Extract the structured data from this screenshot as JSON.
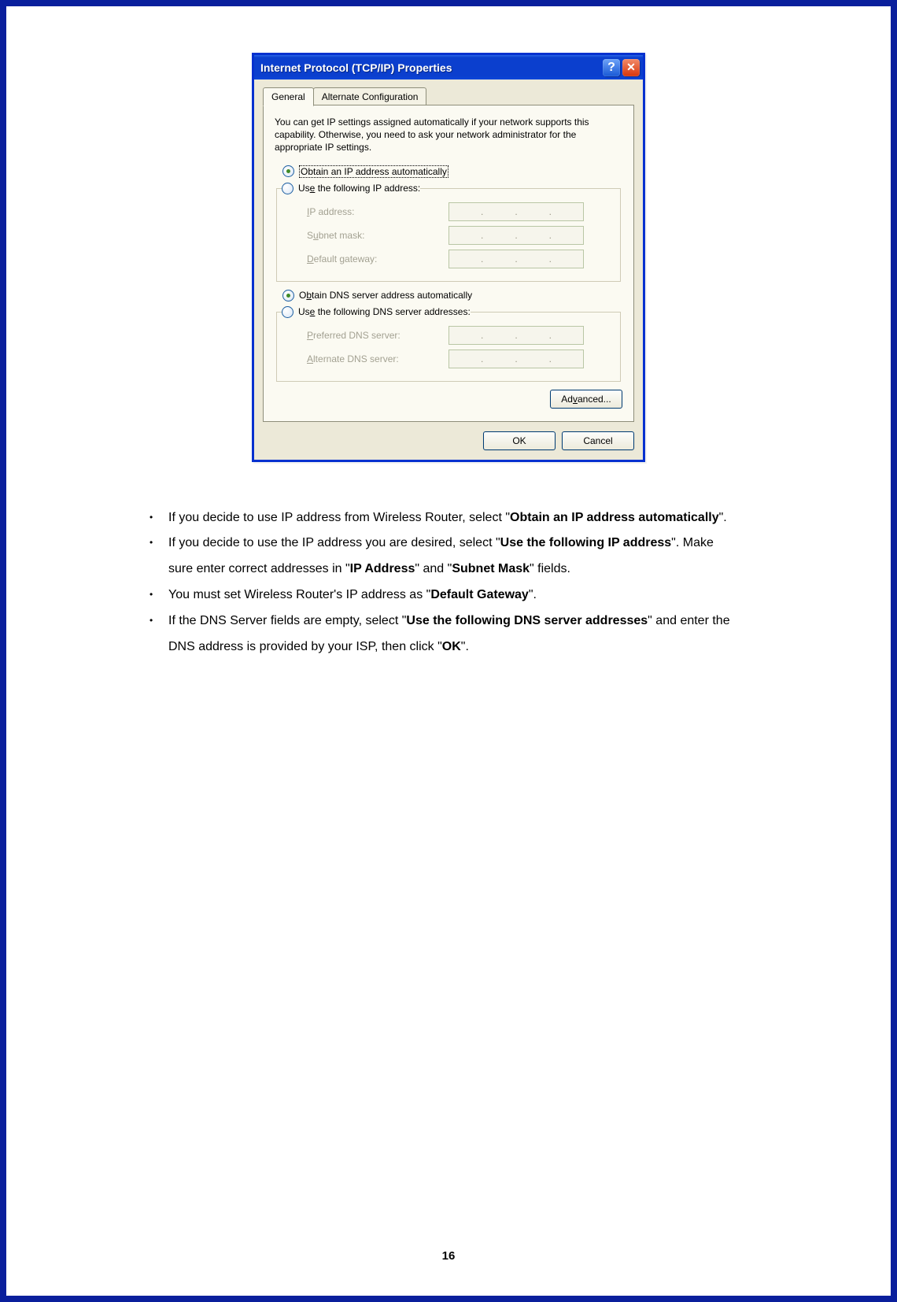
{
  "dialog": {
    "title": "Internet Protocol (TCP/IP) Properties",
    "tabs": {
      "general": "General",
      "alt": "Alternate Configuration"
    },
    "desc": "You can get IP settings assigned automatically if your network supports this capability. Otherwise, you need to ask your network administrator for the appropriate IP settings.",
    "radio_auto_ip": "Obtain an IP address automatically",
    "radio_use_ip_pre": "Us",
    "radio_use_ip_u": "e",
    "radio_use_ip_post": " the following IP address:",
    "ip_label_u": "I",
    "ip_label_post": "P address:",
    "subnet_pre": "S",
    "subnet_u": "u",
    "subnet_post": "bnet mask:",
    "gateway_u": "D",
    "gateway_post": "efault gateway:",
    "radio_auto_dns_pre": "O",
    "radio_auto_dns_u": "b",
    "radio_auto_dns_post": "tain DNS server address automatically",
    "radio_use_dns_pre": "Us",
    "radio_use_dns_u": "e",
    "radio_use_dns_post": " the following DNS server addresses:",
    "pref_dns_u": "P",
    "pref_dns_post": "referred DNS server:",
    "alt_dns_u": "A",
    "alt_dns_post": "lternate DNS server:",
    "advanced_pre": "Ad",
    "advanced_u": "v",
    "advanced_post": "anced...",
    "ok": "OK",
    "cancel": "Cancel"
  },
  "bullets": {
    "b1_a": "If you decide to use IP address from Wireless Router, select \"",
    "b1_bold": "Obtain an IP address automatically",
    "b1_b": "\".",
    "b2_a": "If you decide to use the IP address you are desired, select \"",
    "b2_bold1": "Use the following IP address",
    "b2_b": "\".    Make sure enter correct addresses in \"",
    "b2_bold2": "IP Address",
    "b2_c": "\" and \"",
    "b2_bold3": "Subnet Mask",
    "b2_d": "\" fields.",
    "b3_a": "You must set Wireless Router's IP address as \"",
    "b3_bold": "Default Gateway",
    "b3_b": "\".",
    "b4_a": "If the DNS Server fields are empty, select \"",
    "b4_bold1": "Use the following DNS server addresses",
    "b4_b": "\" and enter the DNS address is provided by your ISP, then click \"",
    "b4_bold2": "OK",
    "b4_c": "\"."
  },
  "page_number": "16"
}
